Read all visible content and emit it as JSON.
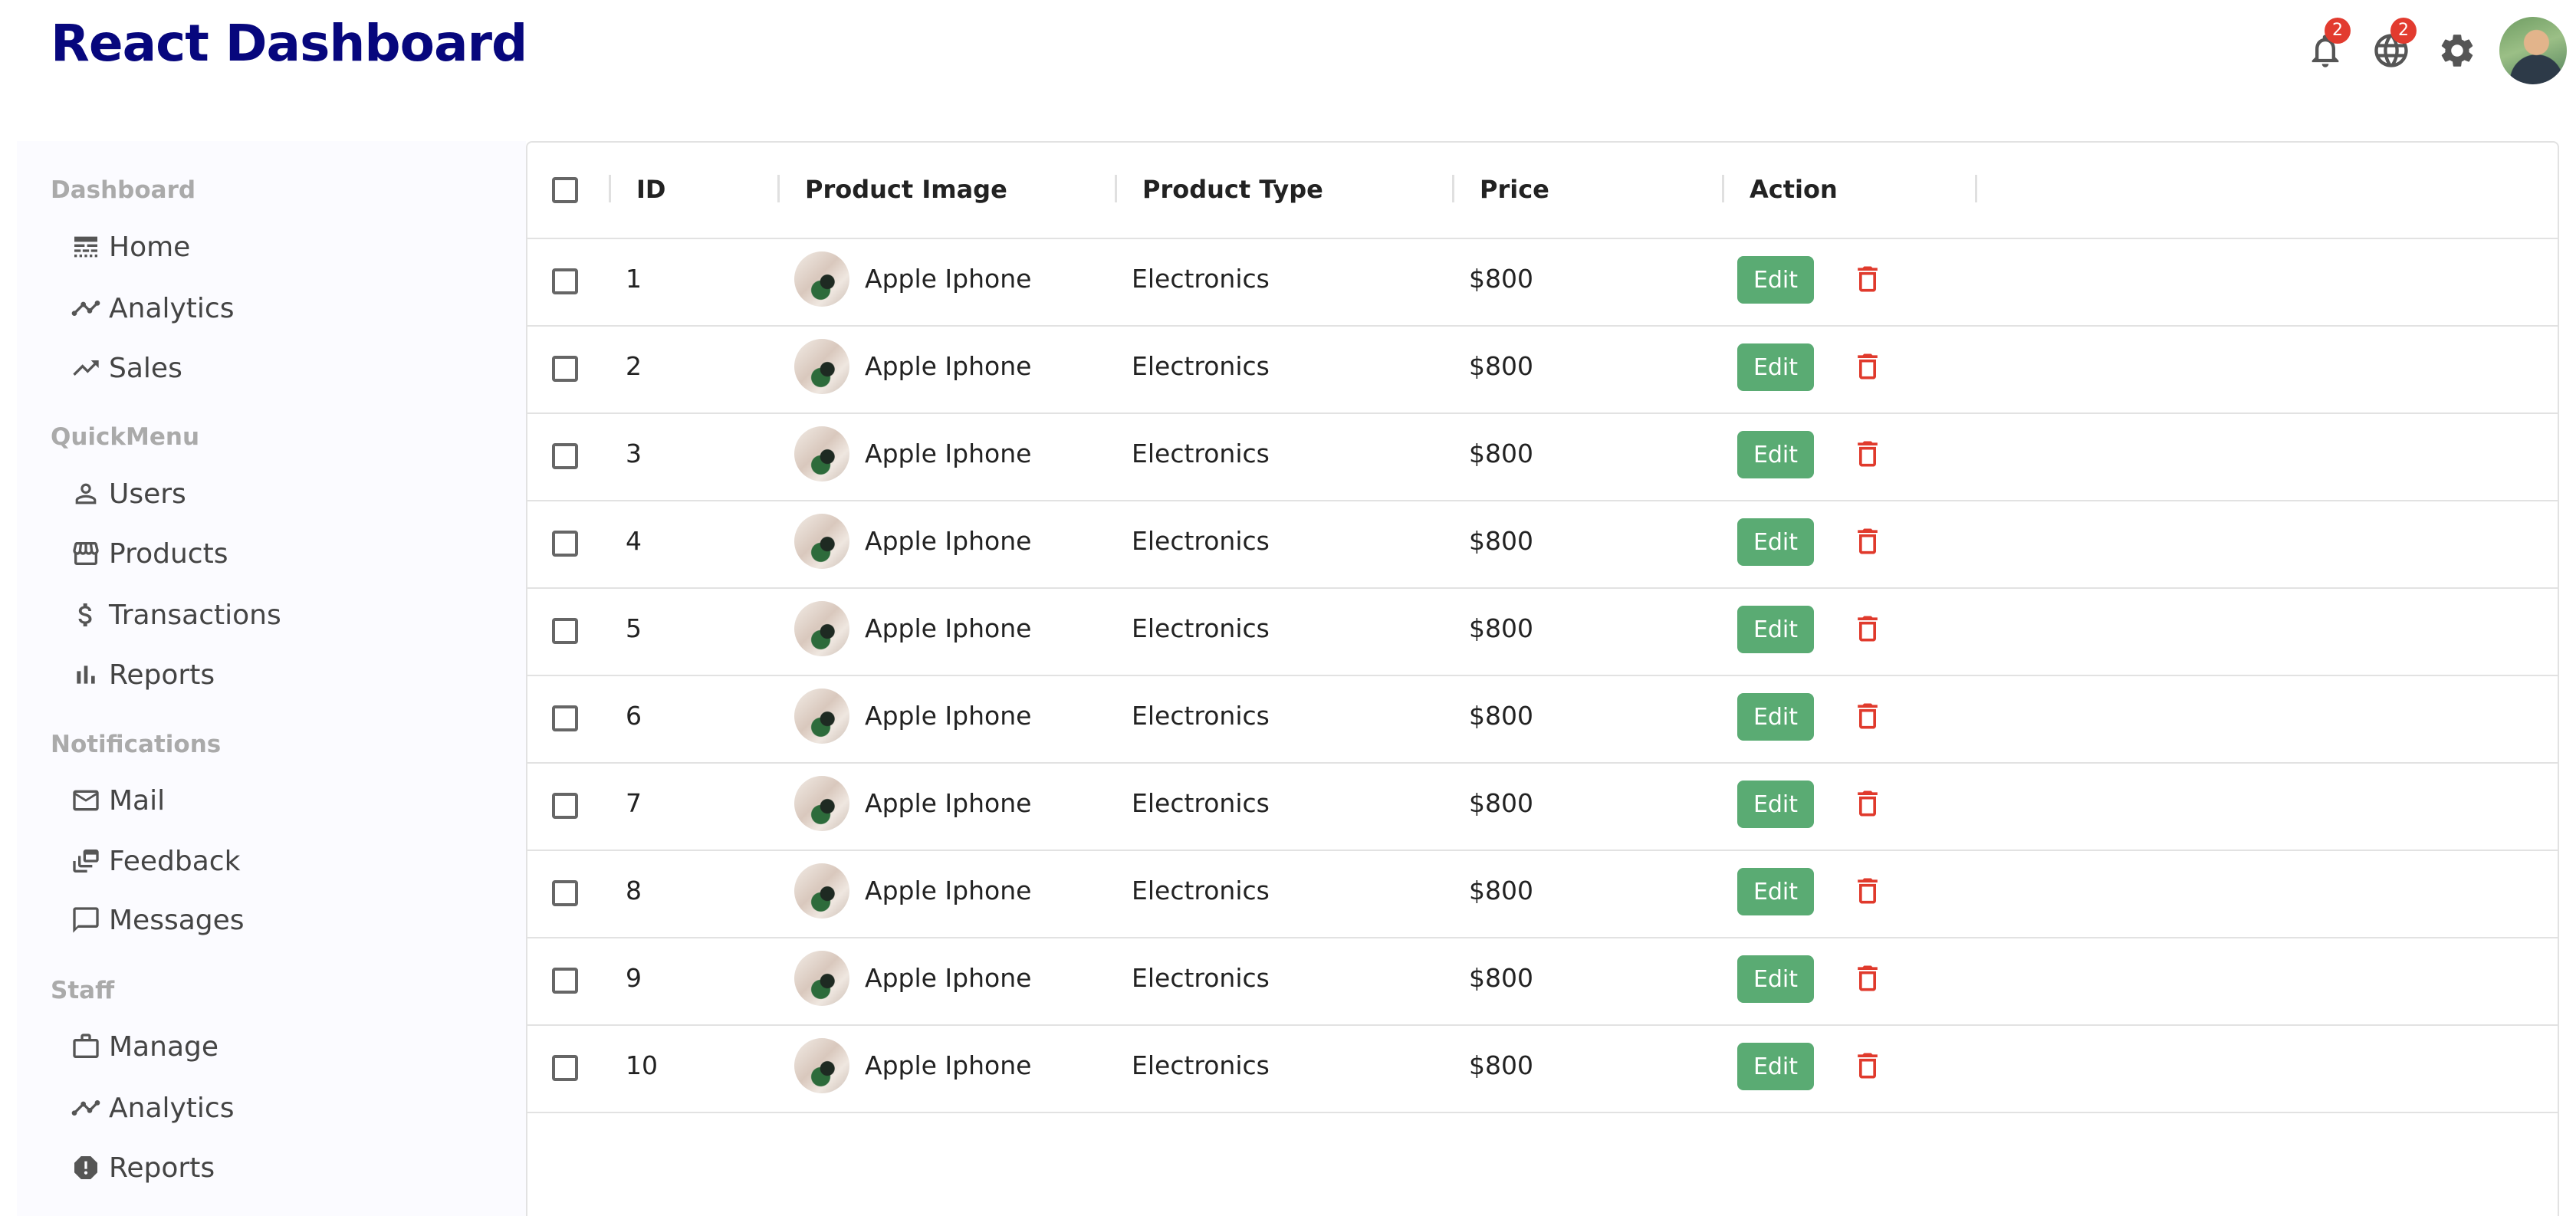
{
  "app": {
    "title": "React Dashboard"
  },
  "topbar": {
    "notifications_badge": "2",
    "language_badge": "2",
    "icons": [
      "bell-icon",
      "globe-icon",
      "gear-icon",
      "avatar"
    ]
  },
  "sidebar": {
    "sections": [
      {
        "title": "Dashboard",
        "items": [
          {
            "label": "Home",
            "icon": "line-style-icon"
          },
          {
            "label": "Analytics",
            "icon": "timeline-icon"
          },
          {
            "label": "Sales",
            "icon": "trending-up-icon"
          }
        ]
      },
      {
        "title": "QuickMenu",
        "items": [
          {
            "label": "Users",
            "icon": "person-outline-icon"
          },
          {
            "label": "Products",
            "icon": "storefront-icon"
          },
          {
            "label": "Transactions",
            "icon": "dollar-icon"
          },
          {
            "label": "Reports",
            "icon": "bar-chart-icon"
          }
        ]
      },
      {
        "title": "Notifications",
        "items": [
          {
            "label": "Mail",
            "icon": "mail-outline-icon"
          },
          {
            "label": "Feedback",
            "icon": "dynamic-feed-icon"
          },
          {
            "label": "Messages",
            "icon": "chat-bubble-outline-icon"
          }
        ]
      },
      {
        "title": "Staff",
        "items": [
          {
            "label": "Manage",
            "icon": "work-outline-icon"
          },
          {
            "label": "Analytics",
            "icon": "timeline-icon"
          },
          {
            "label": "Reports",
            "icon": "report-icon"
          }
        ]
      }
    ]
  },
  "table": {
    "columns": [
      "ID",
      "Product Image",
      "Product Type",
      "Price",
      "Action"
    ],
    "edit_label": "Edit",
    "rows": [
      {
        "id": "1",
        "name": "Apple Iphone",
        "type": "Electronics",
        "price": "$800"
      },
      {
        "id": "2",
        "name": "Apple Iphone",
        "type": "Electronics",
        "price": "$800"
      },
      {
        "id": "3",
        "name": "Apple Iphone",
        "type": "Electronics",
        "price": "$800"
      },
      {
        "id": "4",
        "name": "Apple Iphone",
        "type": "Electronics",
        "price": "$800"
      },
      {
        "id": "5",
        "name": "Apple Iphone",
        "type": "Electronics",
        "price": "$800"
      },
      {
        "id": "6",
        "name": "Apple Iphone",
        "type": "Electronics",
        "price": "$800"
      },
      {
        "id": "7",
        "name": "Apple Iphone",
        "type": "Electronics",
        "price": "$800"
      },
      {
        "id": "8",
        "name": "Apple Iphone",
        "type": "Electronics",
        "price": "$800"
      },
      {
        "id": "9",
        "name": "Apple Iphone",
        "type": "Electronics",
        "price": "$800"
      },
      {
        "id": "10",
        "name": "Apple Iphone",
        "type": "Electronics",
        "price": "$800"
      }
    ]
  },
  "colors": {
    "brand": "#07077d",
    "edit_button": "#5aab73",
    "delete_icon": "#e03a2c",
    "badge": "#e23b2f",
    "sidebar_bg": "#fbfbff"
  }
}
